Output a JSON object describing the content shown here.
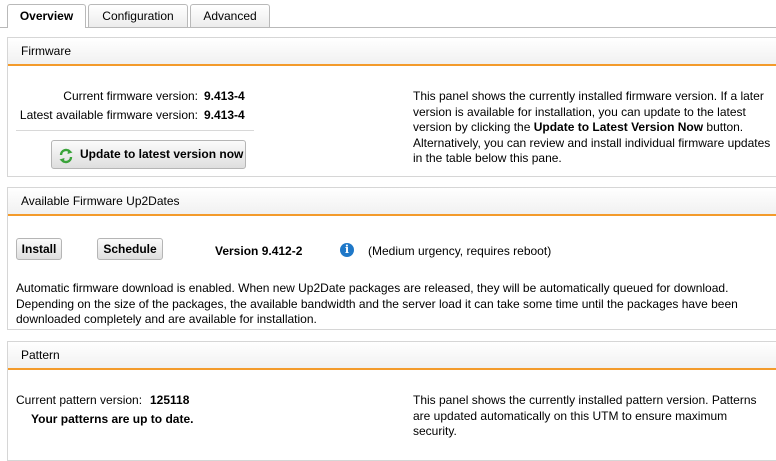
{
  "tabs": [
    {
      "label": "Overview",
      "active": true
    },
    {
      "label": "Configuration",
      "active": false
    },
    {
      "label": "Advanced",
      "active": false
    }
  ],
  "colors": {
    "accent": "#f39b2b",
    "info": "#1f78c8",
    "refresh": "#3aa33a"
  },
  "firmware": {
    "title": "Firmware",
    "current_label": "Current firmware version:",
    "current_value": "9.413-4",
    "latest_label": "Latest available firmware version:",
    "latest_value": "9.413-4",
    "update_button": "Update to latest version now",
    "update_icon": "refresh-icon",
    "desc_1": "This panel shows the currently installed firmware version. If a later version is available for installation, you can update to the latest version by clicking the ",
    "desc_bold": "Update to Latest Version Now",
    "desc_2": " button. Alternatively, you can review and install individual firmware updates in the table below this pane."
  },
  "up2dates": {
    "title": "Available Firmware Up2Dates",
    "install_button": "Install",
    "schedule_button": "Schedule",
    "version": "Version 9.412-2",
    "info_icon": "info-icon",
    "note": "(Medium urgency, requires reboot)",
    "description": "Automatic firmware download is enabled. When new Up2Date packages are released, they will be automatically queued for download. Depending on the size of the packages, the available bandwidth and the server load it can take some time until the packages have been downloaded completely and are available for installation."
  },
  "pattern": {
    "title": "Pattern",
    "current_label": "Current pattern version:",
    "current_value": "125118",
    "status": "Your patterns are up to date.",
    "description": "This panel shows the currently installed pattern version. Patterns are updated automatically on this UTM to ensure maximum security."
  }
}
